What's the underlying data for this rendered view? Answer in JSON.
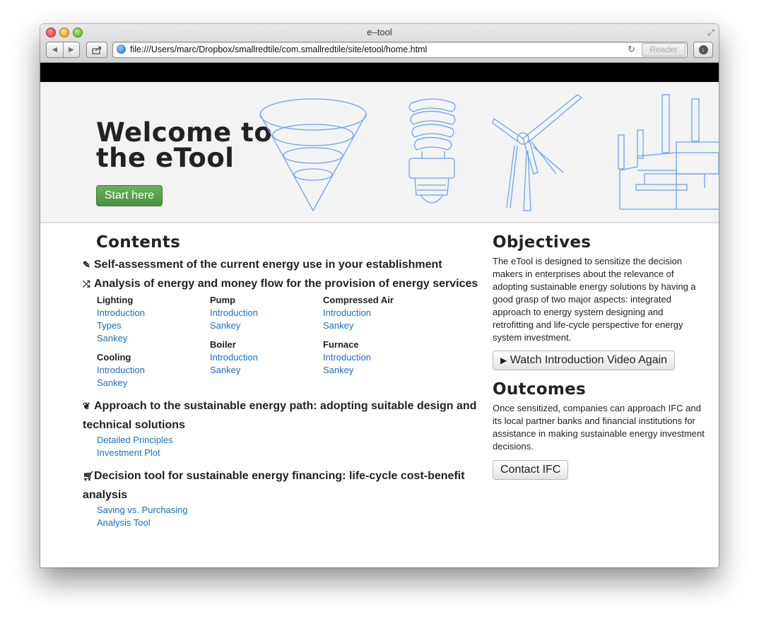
{
  "browser": {
    "title": "e–tool",
    "url": "file:///Users/marc/Dropbox/smallredtile/com.smallredtile/site/etool/home.html",
    "reader_label": "Reader"
  },
  "hero": {
    "title_line1": "Welcome to",
    "title_line2": "the eTool",
    "start_label": "Start here",
    "illustration_color": "#6fa4f0"
  },
  "contents": {
    "title": "Contents",
    "sections": [
      {
        "icon": "pencil-icon",
        "title": "Self-assessment of the current energy use in your establishment"
      },
      {
        "icon": "shuffle-icon",
        "title": "Analysis of energy and money flow for the provision of energy services",
        "groups": [
          {
            "title": "Lighting",
            "links": [
              "Introduction",
              "Types",
              "Sankey"
            ]
          },
          {
            "title": "Pump",
            "links": [
              "Introduction",
              "Sankey"
            ]
          },
          {
            "title": "Compressed Air",
            "links": [
              "Introduction",
              "Sankey"
            ]
          },
          {
            "title": "Cooling",
            "links": [
              "Introduction",
              "Sankey"
            ]
          },
          {
            "title": "Boiler",
            "links": [
              "Introduction",
              "Sankey"
            ]
          },
          {
            "title": "Furnace",
            "links": [
              "Introduction",
              "Sankey"
            ]
          }
        ]
      },
      {
        "icon": "leaf-icon",
        "title": "Approach to the sustainable energy path: adopting suitable design and technical solutions",
        "links": [
          "Detailed Principles",
          "Investment Plot"
        ]
      },
      {
        "icon": "cart-icon",
        "title": "Decision tool for sustainable energy financing: life-cycle cost-benefit analysis",
        "links": [
          "Saving vs. Purchasing",
          "Analysis Tool"
        ]
      }
    ]
  },
  "objectives": {
    "title": "Objectives",
    "text": "The eTool is designed to sensitize the decision makers in enterprises about the relevance of adopting sustainable energy solutions by having a good grasp of two major aspects: integrated approach to energy system designing and retrofitting and life-cycle perspective for energy system investment.",
    "video_label": "Watch Introduction Video Again"
  },
  "outcomes": {
    "title": "Outcomes",
    "text": "Once sensitized, companies can approach IFC and its local partner banks and financial institutions for assistance in making sustainable energy investment decisions.",
    "contact_label": "Contact IFC"
  },
  "colors": {
    "link": "#1d6fbf",
    "start_button": "#56a04b"
  }
}
